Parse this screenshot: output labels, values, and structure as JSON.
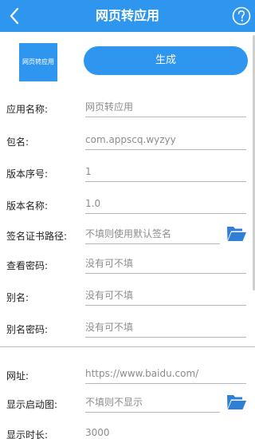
{
  "header": {
    "title": "网页转应用",
    "back_icon": "back-arrow-icon",
    "help_icon": "help-circle-icon"
  },
  "app_icon_text": "网页转应用",
  "generate_label": "生成",
  "fields": [
    {
      "label": "应用名称:",
      "value": "网页转应用"
    },
    {
      "label": "包名:",
      "value": "com.appscq.wyzyy"
    },
    {
      "label": "版本序号:",
      "value": "1"
    },
    {
      "label": "版本名称:",
      "value": "1.0"
    },
    {
      "label": "签名证书路径:",
      "placeholder": "不填则使用默认签名"
    },
    {
      "label": "查看密码:",
      "placeholder": "没有可不填"
    },
    {
      "label": "别名:",
      "placeholder": "没有可不填"
    },
    {
      "label": "别名密码:",
      "placeholder": "没有可不填"
    },
    {
      "label": "网址:",
      "value": "https://www.baidu.com/"
    },
    {
      "label": "显示启动图:",
      "placeholder": "不填则不显示"
    },
    {
      "label": "显示时长:",
      "value": "3000"
    }
  ],
  "colors": {
    "primary": "#2f96f0",
    "folder_icon": "#2f7fd6"
  }
}
